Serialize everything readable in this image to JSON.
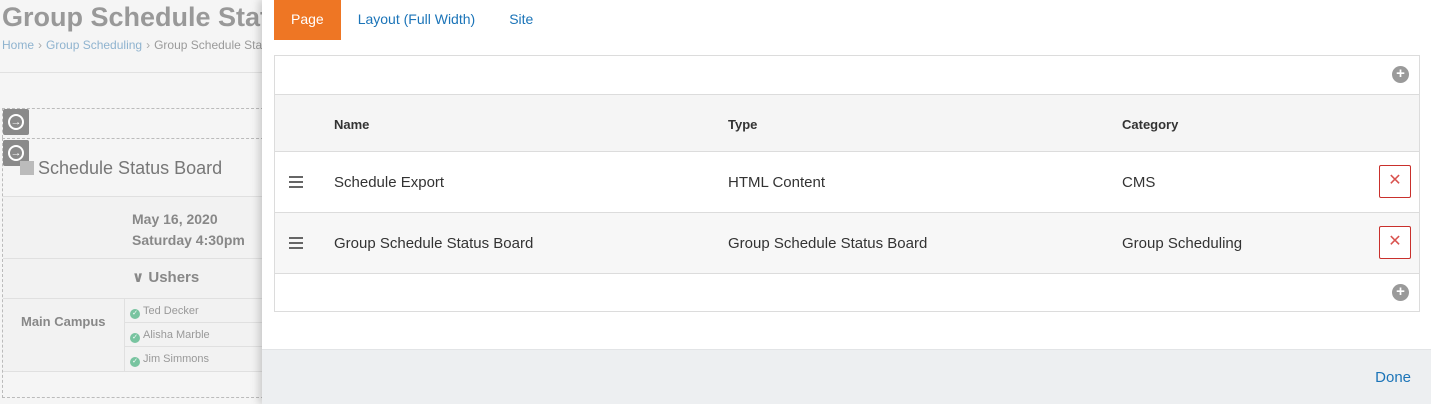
{
  "background": {
    "page_title": "Group Schedule Stat",
    "breadcrumbs": [
      "Home",
      "Group Scheduling",
      "Group Schedule Sta"
    ],
    "block_title": "Schedule Status Board",
    "date": "May 16, 2020",
    "time": "Saturday 4:30pm",
    "group": "Ushers",
    "campus": "Main Campus",
    "people": [
      "Ted Decker",
      "Alisha Marble",
      "Jim Simmons"
    ]
  },
  "modal": {
    "tabs": [
      {
        "label": "Page",
        "active": true
      },
      {
        "label": "Layout (Full Width)",
        "active": false
      },
      {
        "label": "Site",
        "active": false
      }
    ],
    "columns": {
      "name": "Name",
      "type": "Type",
      "category": "Category"
    },
    "rows": [
      {
        "name": "Schedule Export",
        "type": "HTML Content",
        "category": "CMS"
      },
      {
        "name": "Group Schedule Status Board",
        "type": "Group Schedule Status Board",
        "category": "Group Scheduling"
      }
    ],
    "done_label": "Done"
  },
  "colors": {
    "active_tab": "#ee7624",
    "link": "#1b74b8",
    "delete": "#d9534f"
  },
  "icons": {
    "add": "plus-circle",
    "delete": "times",
    "drag": "bars",
    "move": "arrow-circle-right",
    "check": "check-circle"
  }
}
